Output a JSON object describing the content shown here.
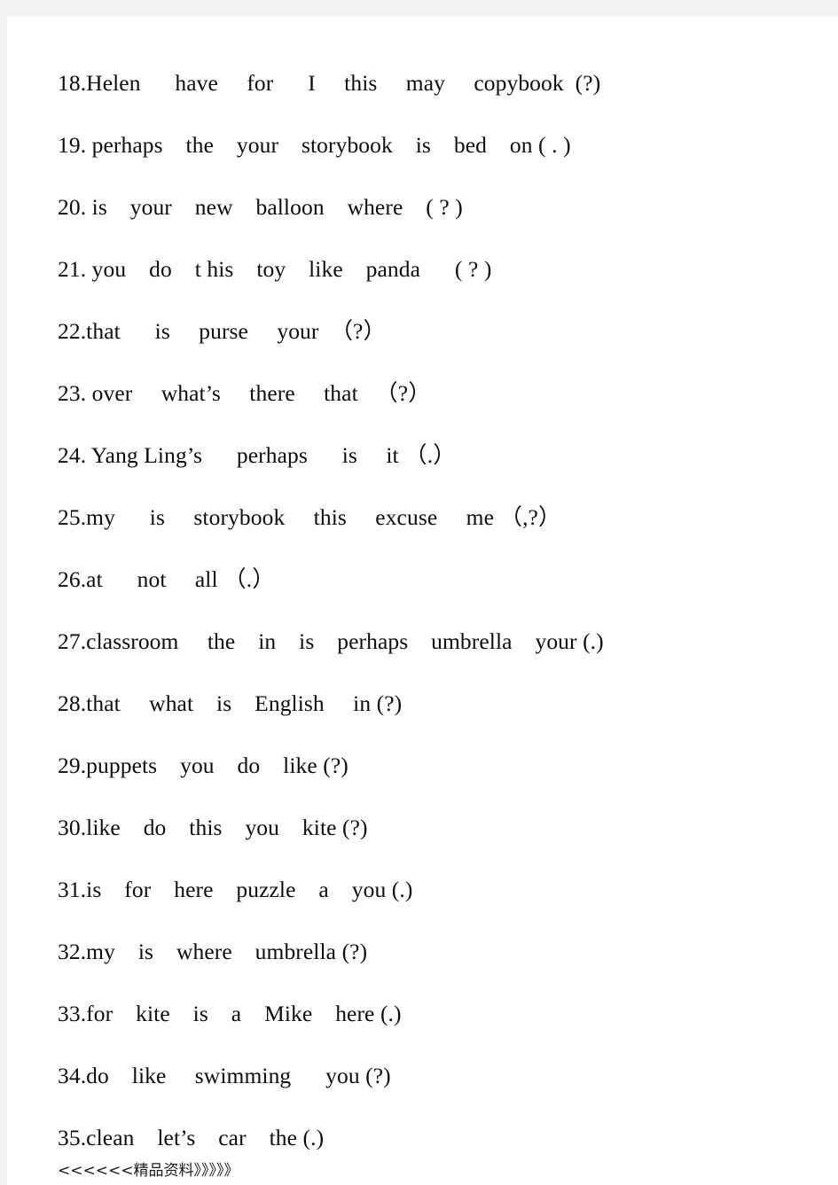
{
  "document": {
    "type": "worksheet-scan",
    "page_background": "#ffffff",
    "margin_band_color": "#f4f4f4",
    "text_color": "#100c08"
  },
  "exercises": [
    {
      "number": "18.",
      "text": "18.Helen      have     for      I     this     may     copybook  (?)"
    },
    {
      "number": "19.",
      "text": "19. perhaps    the    your    storybook    is    bed    on ( . )"
    },
    {
      "number": "20.",
      "text": "20. is    your    new    balloon    where    ( ? )"
    },
    {
      "number": "21.",
      "text": "21. you    do    t his    toy    like    panda      ( ? )"
    },
    {
      "number": "22.",
      "text": "22.that      is     purse     your  （?）"
    },
    {
      "number": "23.",
      "text": "23. over     what’s     there     that   （?）"
    },
    {
      "number": "24.",
      "text": "24. Yang Ling’s      perhaps      is     it （.）"
    },
    {
      "number": "25.",
      "text": "25.my      is     storybook     this     excuse     me （,?）"
    },
    {
      "number": "26.",
      "text": "26.at      not     all （.）"
    },
    {
      "number": "27.",
      "text": "27.classroom     the    in    is    perhaps    umbrella    your (.)"
    },
    {
      "number": "28.",
      "text": "28.that     what    is    English     in (?)"
    },
    {
      "number": "29.",
      "text": "29.puppets    you    do    like (?)"
    },
    {
      "number": "30.",
      "text": "30.like    do    this    you    kite (?)"
    },
    {
      "number": "31.",
      "text": "31.is    for    here    puzzle    a    you (.)"
    },
    {
      "number": "32.",
      "text": "32.my    is    where    umbrella (?)"
    },
    {
      "number": "33.",
      "text": "33.for    kite    is    a    Mike    here (.)"
    },
    {
      "number": "34.",
      "text": "34.do    like     swimming      you (?)"
    },
    {
      "number": "35.",
      "text": "35.clean    let’s    car    the (.)"
    }
  ],
  "footer": {
    "watermark": "<<<<<<精品资料》》》》》"
  }
}
